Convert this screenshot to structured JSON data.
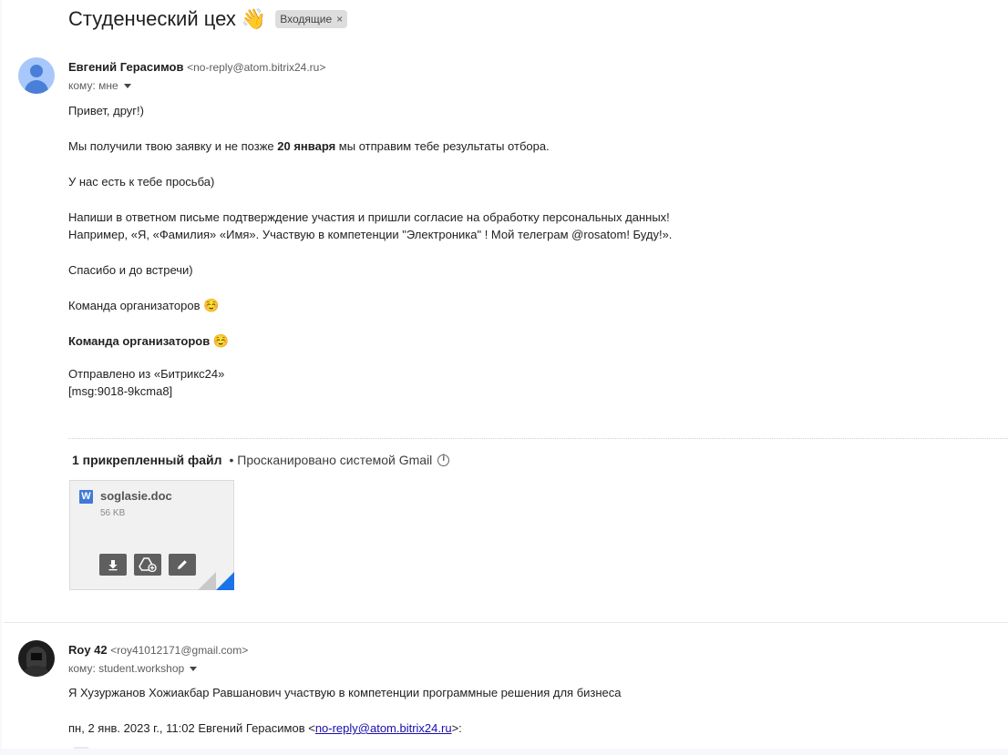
{
  "thread": {
    "subject": "Студенческий цех",
    "subject_emoji": "👋",
    "label": "Входящие",
    "label_remove": "×"
  },
  "message1": {
    "sender_name": "Евгений Герасимов",
    "sender_email": "<no-reply@atom.bitrix24.ru>",
    "to_text": "кому: мне",
    "body": {
      "greeting": "Привет, друг!)",
      "p2_before": "Мы получили твою заявку и не позже ",
      "p2_bold": "20 января",
      "p2_after": " мы отправим тебе результаты отбора.",
      "p3": "У нас есть к тебе просьба)",
      "p4_line1": "Напиши в ответном письме подтверждение участия и пришли согласие на обработку персональных данных!",
      "p4_line2": "Например, «Я, «Фамилия» «Имя». Участвую в компетенции  \"Электроника\" ! Мой телеграм @rosatom! Буду!».",
      "p5": "Спасибо и до встречи)",
      "sign1": "Команда организаторов",
      "sign1_emoji": "☺️",
      "sign2": "Команда организаторов",
      "sign2_emoji": "☺️",
      "footer1": "Отправлено из «Битрикс24»",
      "footer2": "[msg:9018-9kcma8]"
    },
    "attachments_header": {
      "count_label": "1 прикрепленный файл",
      "scan_label": "• Просканировано системой Gmail"
    },
    "attachment": {
      "icon_letter": "W",
      "file_name": "soglasie.doc",
      "file_size": "56 KB"
    }
  },
  "message2": {
    "sender_name": "Roy 42",
    "sender_email": "<roy41012171@gmail.com>",
    "to_text": "кому: student.workshop",
    "body": "Я Хузуржанов Хожиакбар Равшанович участвую в компетенции программные решения для бизнеса",
    "quote_prefix": "пн, 2 янв. 2023 г., 11:02 Евгений Герасимов <",
    "quote_link": "no-reply@atom.bitrix24.ru",
    "quote_suffix": ">:"
  },
  "colors": {
    "accent_blue": "#1a73e8",
    "word_blue": "#3f7ad6",
    "avatar_light": "#a8c7fa",
    "avatar_dark": "#4a7fd8"
  }
}
